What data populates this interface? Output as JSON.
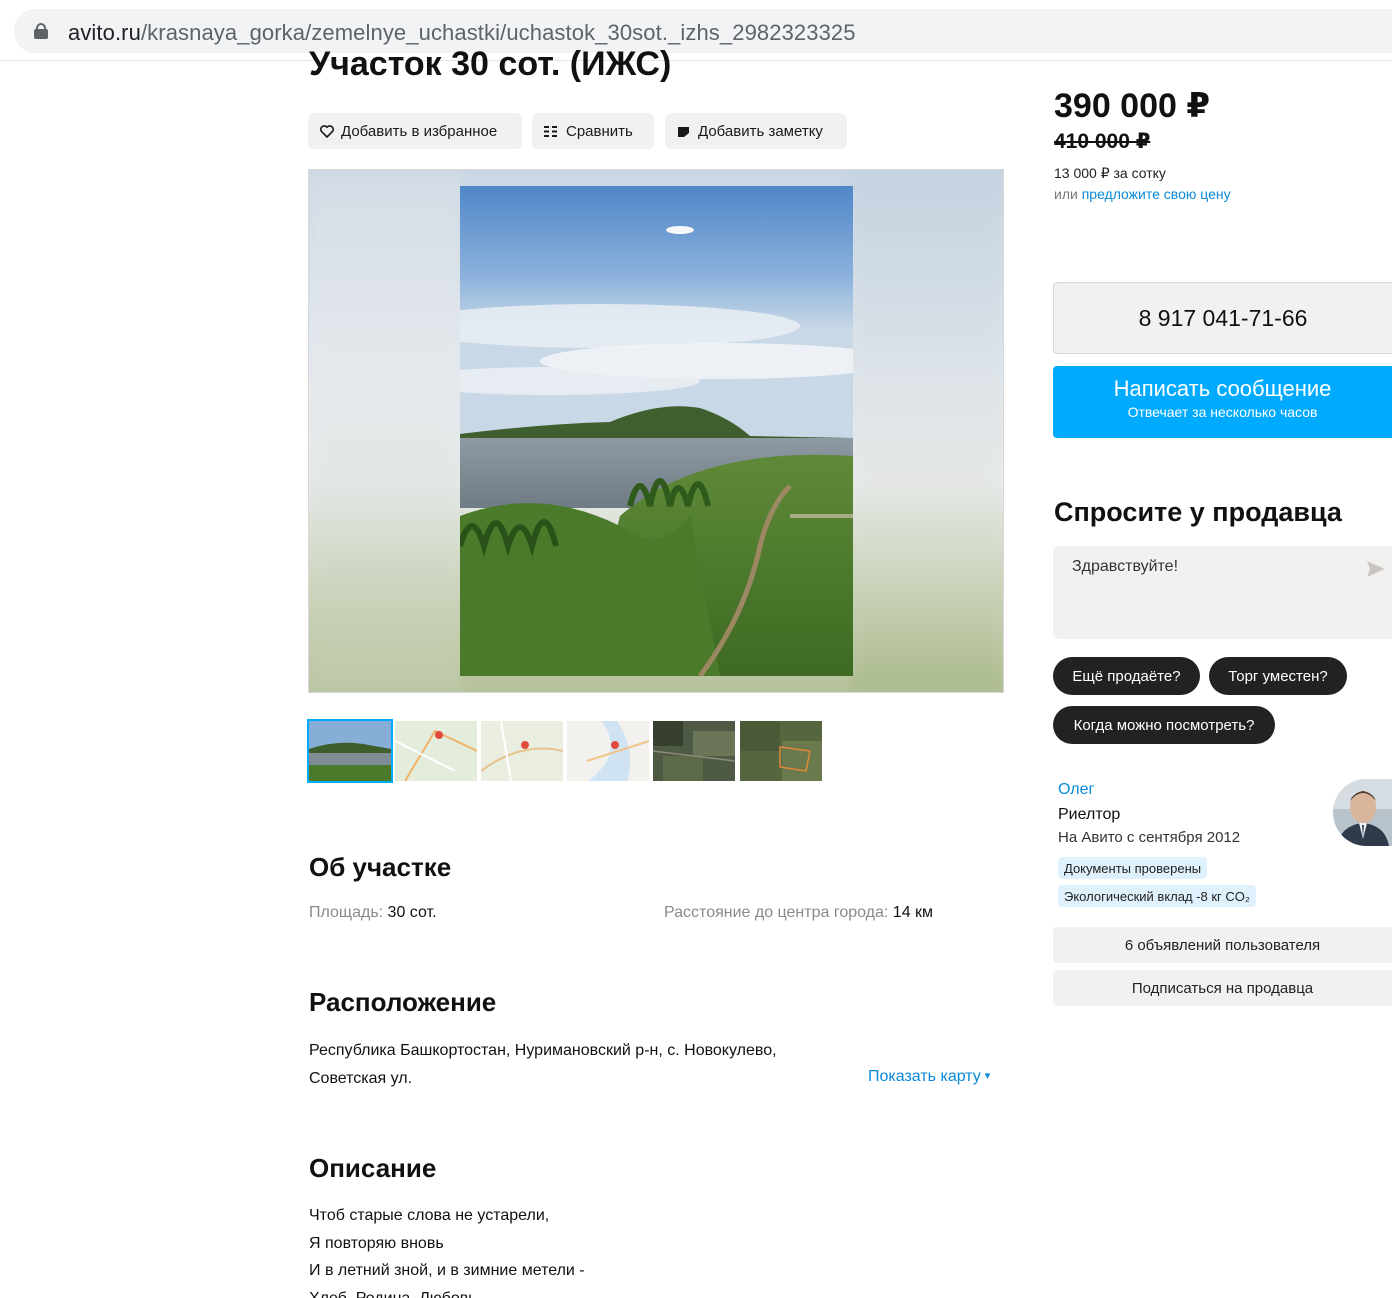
{
  "browser": {
    "url_host": "avito.ru",
    "url_path": "/krasnaya_gorka/zemelnye_uchastki/uchastok_30sot._izhs_2982323325"
  },
  "listing": {
    "title": "Участок 30 сот. (ИЖС)",
    "actions": {
      "favorite": "Добавить в избранное",
      "compare": "Сравнить",
      "note": "Добавить заметку"
    },
    "gallery": {
      "thumbs": [
        "photo-lake",
        "map-1",
        "map-2",
        "map-3",
        "satellite-1",
        "satellite-2"
      ],
      "active_index": 0
    },
    "about": {
      "heading": "Об участке",
      "area_label": "Площадь:",
      "area_value": "30 сот.",
      "distance_label": "Расстояние до центра города:",
      "distance_value": "14 км"
    },
    "location": {
      "heading": "Расположение",
      "address_line1": "Республика Башкортостан, Нуримановский р-н, с. Новокулево,",
      "address_line2": "Советская ул.",
      "show_map": "Показать карту"
    },
    "description": {
      "heading": "Описание",
      "lines": [
        "Чтоб старые слова не устарели,",
        "Я повторяю вновь",
        "И в летний зной, и в зимние метели -",
        "Хлеб, Родина, Любовь"
      ]
    }
  },
  "sidebar": {
    "price": "390 000 ₽",
    "old_price": "410 000 ₽",
    "per_unit": "13 000 ₽ за сотку",
    "offer_prefix": "или",
    "offer_link": "предложите свою цену",
    "phone": "8 917 041-71-66",
    "message_button": "Написать сообщение",
    "message_sub": "Отвечает за несколько часов",
    "ask_heading": "Спросите у продавца",
    "ask_placeholder": "Здравствуйте!",
    "chips": [
      "Ещё продаёте?",
      "Торг уместен?",
      "Когда можно посмотреть?"
    ],
    "seller": {
      "name": "Олег",
      "role": "Риелтор",
      "since": "На Авито с сентября 2012",
      "badge_docs": "Документы проверены",
      "badge_eco": "Экологический вклад -8 кг CO₂"
    },
    "user_listings": "6 объявлений пользователя",
    "subscribe": "Подписаться на продавца"
  },
  "colors": {
    "accent_blue": "#00aaff",
    "link_blue": "#0a8ad8",
    "chip_dark": "#222222",
    "badge_bg": "#dff1fc"
  }
}
